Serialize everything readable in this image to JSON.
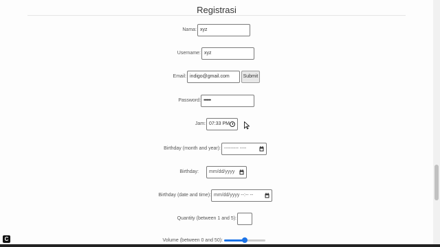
{
  "page": {
    "title": "Registrasi"
  },
  "form": {
    "name": {
      "label": "Nama:",
      "value": "xyz"
    },
    "username": {
      "label": "Username:",
      "value": "xyz"
    },
    "email": {
      "label": "Email:",
      "value": "indigo@gmail.com",
      "submit_label": "Submit"
    },
    "password": {
      "label": "Password:",
      "value": "•••••••"
    },
    "jam": {
      "label": "Jam:",
      "value": "07:33 PM"
    },
    "birthday_month": {
      "label": "Birthday (month and year):",
      "placeholder": "--------- ----"
    },
    "birthday": {
      "label": "Birthday:",
      "placeholder": "mm/dd/yyyy"
    },
    "birthday_datetime": {
      "label": "Birthday (date and time):",
      "placeholder": "mm/dd/yyyy --:-- --"
    },
    "quantity": {
      "label": "Quantity (between 1 and 5):",
      "value": ""
    },
    "volume": {
      "label": "Volume (between 0 and 50):",
      "value_fraction": 0.5
    }
  },
  "corner_badge": {
    "label": "C"
  },
  "colors": {
    "accent": "#1a73e8"
  }
}
